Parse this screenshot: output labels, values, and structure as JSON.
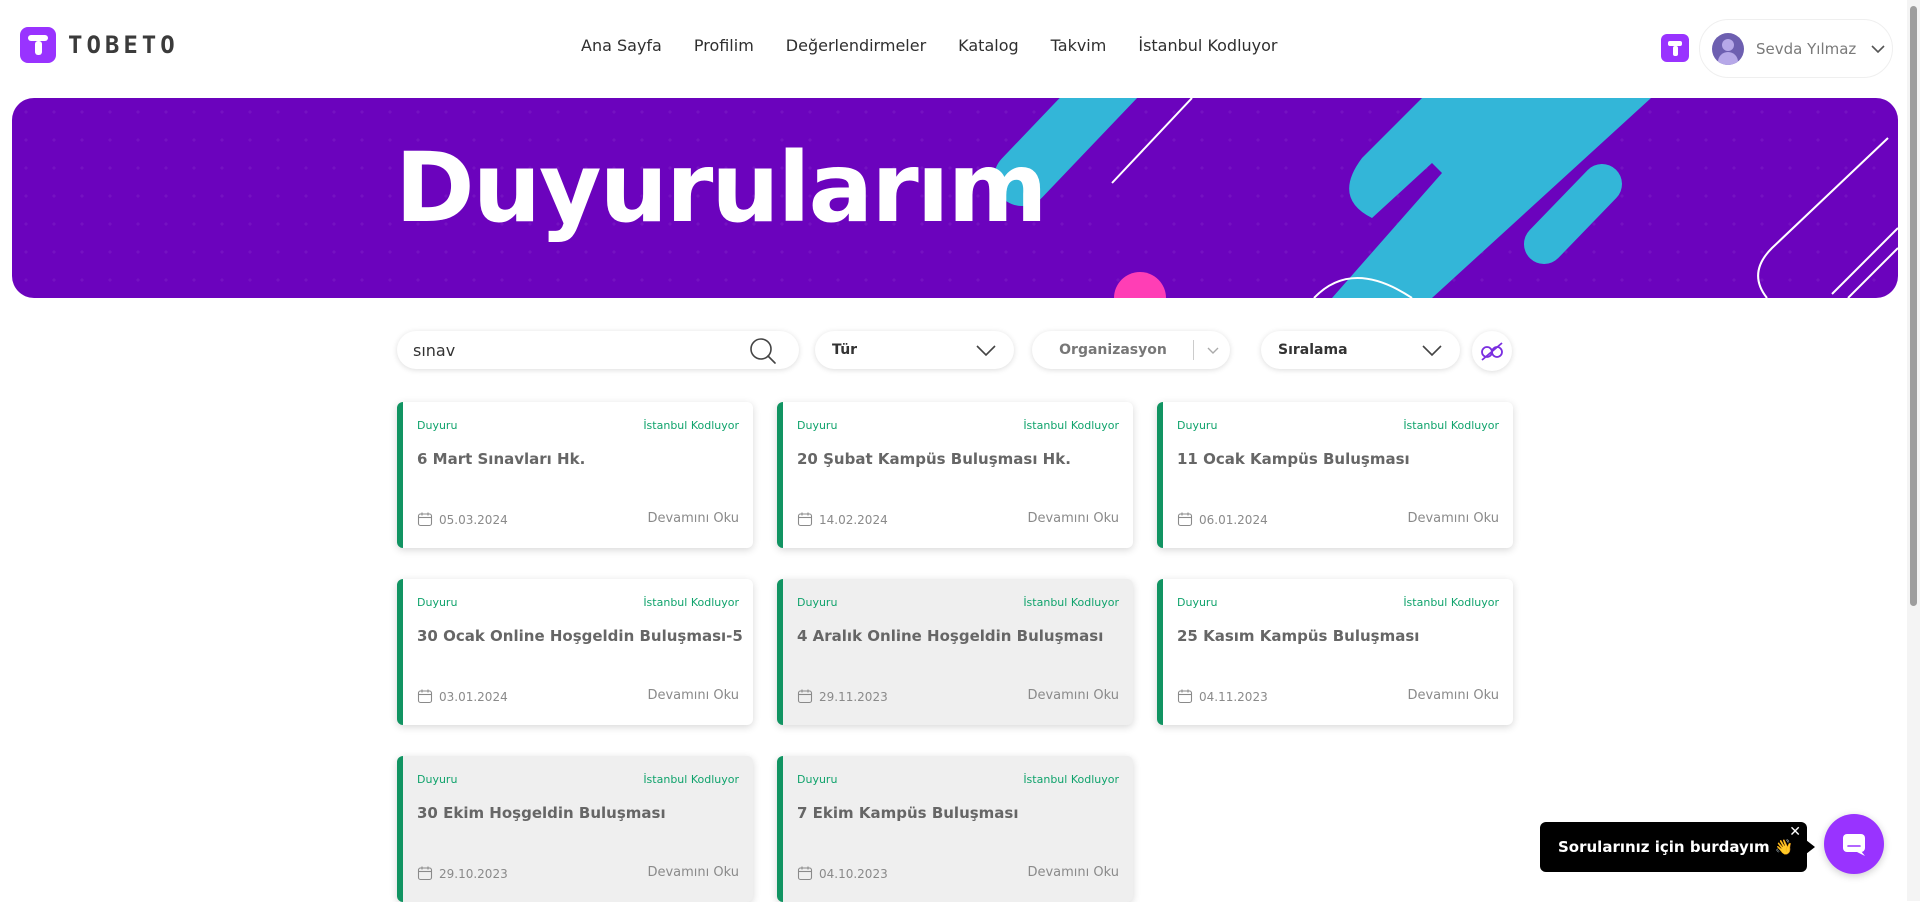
{
  "header": {
    "logo_text": "TOBETO",
    "nav": [
      "Ana Sayfa",
      "Profilim",
      "Değerlendirmeler",
      "Katalog",
      "Takvim",
      "İstanbul Kodluyor"
    ],
    "user_name": "Sevda Yılmaz"
  },
  "banner": {
    "title": "Duyurularım"
  },
  "filters": {
    "search_value": "sınav",
    "type_label": "Tür",
    "organization_label": "Organizasyon",
    "sort_label": "Sıralama"
  },
  "cards": [
    {
      "type": "Duyuru",
      "org": "İstanbul Kodluyor",
      "title": "6 Mart Sınavları Hk.",
      "date": "05.03.2024",
      "more": "Devamını Oku",
      "read": false
    },
    {
      "type": "Duyuru",
      "org": "İstanbul Kodluyor",
      "title": "20 Şubat Kampüs Buluşması Hk.",
      "date": "14.02.2024",
      "more": "Devamını Oku",
      "read": false
    },
    {
      "type": "Duyuru",
      "org": "İstanbul Kodluyor",
      "title": "11 Ocak Kampüs Buluşması",
      "date": "06.01.2024",
      "more": "Devamını Oku",
      "read": false
    },
    {
      "type": "Duyuru",
      "org": "İstanbul Kodluyor",
      "title": "30 Ocak Online Hoşgeldin Buluşması-5",
      "date": "03.01.2024",
      "more": "Devamını Oku",
      "read": false
    },
    {
      "type": "Duyuru",
      "org": "İstanbul Kodluyor",
      "title": "4 Aralık Online Hoşgeldin Buluşması",
      "date": "29.11.2023",
      "more": "Devamını Oku",
      "read": true
    },
    {
      "type": "Duyuru",
      "org": "İstanbul Kodluyor",
      "title": "25 Kasım Kampüs Buluşması",
      "date": "04.11.2023",
      "more": "Devamını Oku",
      "read": false
    },
    {
      "type": "Duyuru",
      "org": "İstanbul Kodluyor",
      "title": "30 Ekim Hoşgeldin Buluşması",
      "date": "29.10.2023",
      "more": "Devamını Oku",
      "read": true
    },
    {
      "type": "Duyuru",
      "org": "İstanbul Kodluyor",
      "title": "7 Ekim Kampüs Buluşması",
      "date": "04.10.2023",
      "more": "Devamını Oku",
      "read": true
    }
  ],
  "chat": {
    "tooltip": "Sorularınız için burdayım 👋",
    "close_symbol": "✕"
  },
  "colors": {
    "brand": "#9933ff",
    "banner_bg": "#6b03bd",
    "accent_green": "#10a36c"
  }
}
